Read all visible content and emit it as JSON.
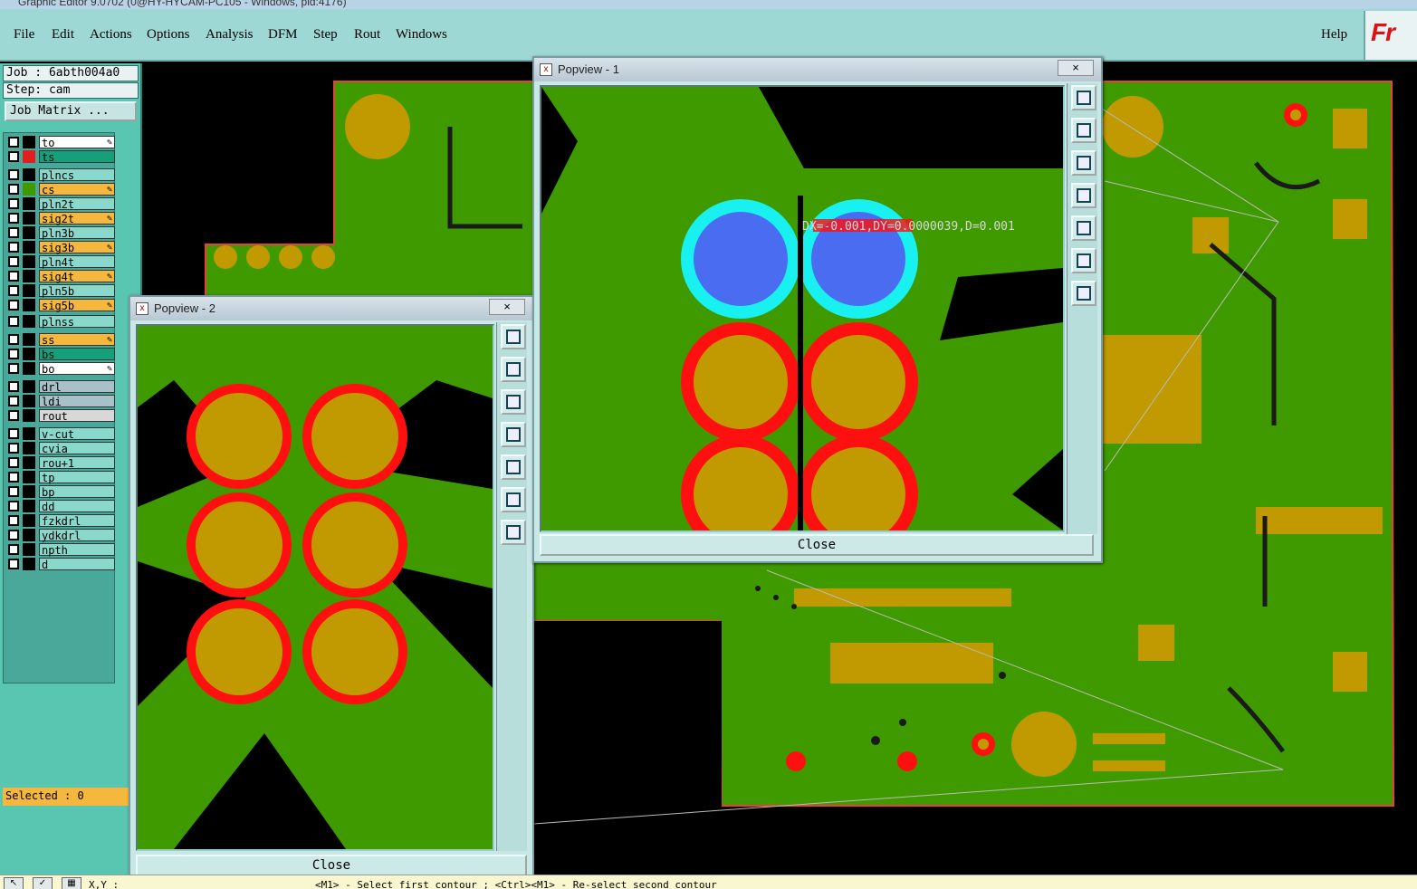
{
  "window": {
    "title": "Graphic Editor 9.0702 (0@HY-HYCAM-PC105 - Windows, pid:4176)"
  },
  "menu": {
    "items": [
      "File",
      "Edit",
      "Actions",
      "Options",
      "Analysis",
      "DFM",
      "Step",
      "Rout",
      "Windows"
    ],
    "help": "Help",
    "logo": "Fr"
  },
  "job": {
    "job_line": "Job : 6abth004a0",
    "step_line": "Step: cam",
    "matrix_button": "Job Matrix ..."
  },
  "layers": [
    {
      "name": "to",
      "color": "#ffffff",
      "swatch": "#000000",
      "pen": true
    },
    {
      "name": "ts",
      "color": "#13a07a",
      "swatch": "#e02020",
      "pen": false
    },
    {
      "name": "plncs",
      "color": "#89d8cc",
      "swatch": "#000000",
      "pen": false
    },
    {
      "name": "cs",
      "color": "#f5b83c",
      "swatch": "#3f9a00",
      "pen": true
    },
    {
      "name": "pln2t",
      "color": "#89d8cc",
      "swatch": "#000000",
      "pen": false
    },
    {
      "name": "sig2t",
      "color": "#f5b83c",
      "swatch": "#000000",
      "pen": true
    },
    {
      "name": "pln3b",
      "color": "#89d8cc",
      "swatch": "#000000",
      "pen": false
    },
    {
      "name": "sig3b",
      "color": "#f5b83c",
      "swatch": "#000000",
      "pen": true
    },
    {
      "name": "pln4t",
      "color": "#89d8cc",
      "swatch": "#000000",
      "pen": false
    },
    {
      "name": "sig4t",
      "color": "#f5b83c",
      "swatch": "#000000",
      "pen": true
    },
    {
      "name": "pln5b",
      "color": "#89d8cc",
      "swatch": "#000000",
      "pen": false
    },
    {
      "name": "sig5b",
      "color": "#f5b83c",
      "swatch": "#000000",
      "pen": true
    },
    {
      "name": "plnss",
      "color": "#89d8cc",
      "swatch": "#000000",
      "pen": false
    },
    {
      "name": "ss",
      "color": "#f5b83c",
      "swatch": "#000000",
      "pen": true
    },
    {
      "name": "bs",
      "color": "#13a07a",
      "swatch": "#000000",
      "pen": false
    },
    {
      "name": "bo",
      "color": "#ffffff",
      "swatch": "#000000",
      "pen": true
    },
    {
      "name": "drl",
      "color": "#a8c0c8",
      "swatch": "#000000",
      "pen": false
    },
    {
      "name": "ldi",
      "color": "#a8c0c8",
      "swatch": "#000000",
      "pen": false
    },
    {
      "name": "rout",
      "color": "#d8d8d8",
      "swatch": "#000000",
      "pen": false
    },
    {
      "name": "v-cut",
      "color": "#89d8cc",
      "swatch": "#000000",
      "pen": false
    },
    {
      "name": "cvia",
      "color": "#89d8cc",
      "swatch": "#000000",
      "pen": false
    },
    {
      "name": "rou+1",
      "color": "#89d8cc",
      "swatch": "#000000",
      "pen": false
    },
    {
      "name": "tp",
      "color": "#89d8cc",
      "swatch": "#000000",
      "pen": false
    },
    {
      "name": "bp",
      "color": "#89d8cc",
      "swatch": "#000000",
      "pen": false
    },
    {
      "name": "dd",
      "color": "#89d8cc",
      "swatch": "#000000",
      "pen": false
    },
    {
      "name": "fzkdrl",
      "color": "#89d8cc",
      "swatch": "#000000",
      "pen": false
    },
    {
      "name": "ydkdrl",
      "color": "#89d8cc",
      "swatch": "#000000",
      "pen": false
    },
    {
      "name": "npth",
      "color": "#89d8cc",
      "swatch": "#000000",
      "pen": false
    },
    {
      "name": "d",
      "color": "#89d8cc",
      "swatch": "#000000",
      "pen": false
    }
  ],
  "selected": "Selected : 0",
  "status": {
    "xy": "X,Y :",
    "prompt": "<M1> - Select first contour ; <Ctrl><M1> - Re-select second contour"
  },
  "popview1": {
    "title": "Popview - 1",
    "close_x": "×",
    "close_button": "Close",
    "measure": "DX=-0.001,DY=0.0000039,D=0.001"
  },
  "popview2": {
    "title": "Popview - 2",
    "close_x": "×",
    "close_button": "Close"
  },
  "colors": {
    "copper": "#3f9a00",
    "pad": "#c09a00",
    "mask": "#ff1010",
    "via": "#4a6cf0",
    "via_ring": "#19f0f0",
    "panel": "#58c6b0",
    "menubar": "#9ed8d5"
  }
}
